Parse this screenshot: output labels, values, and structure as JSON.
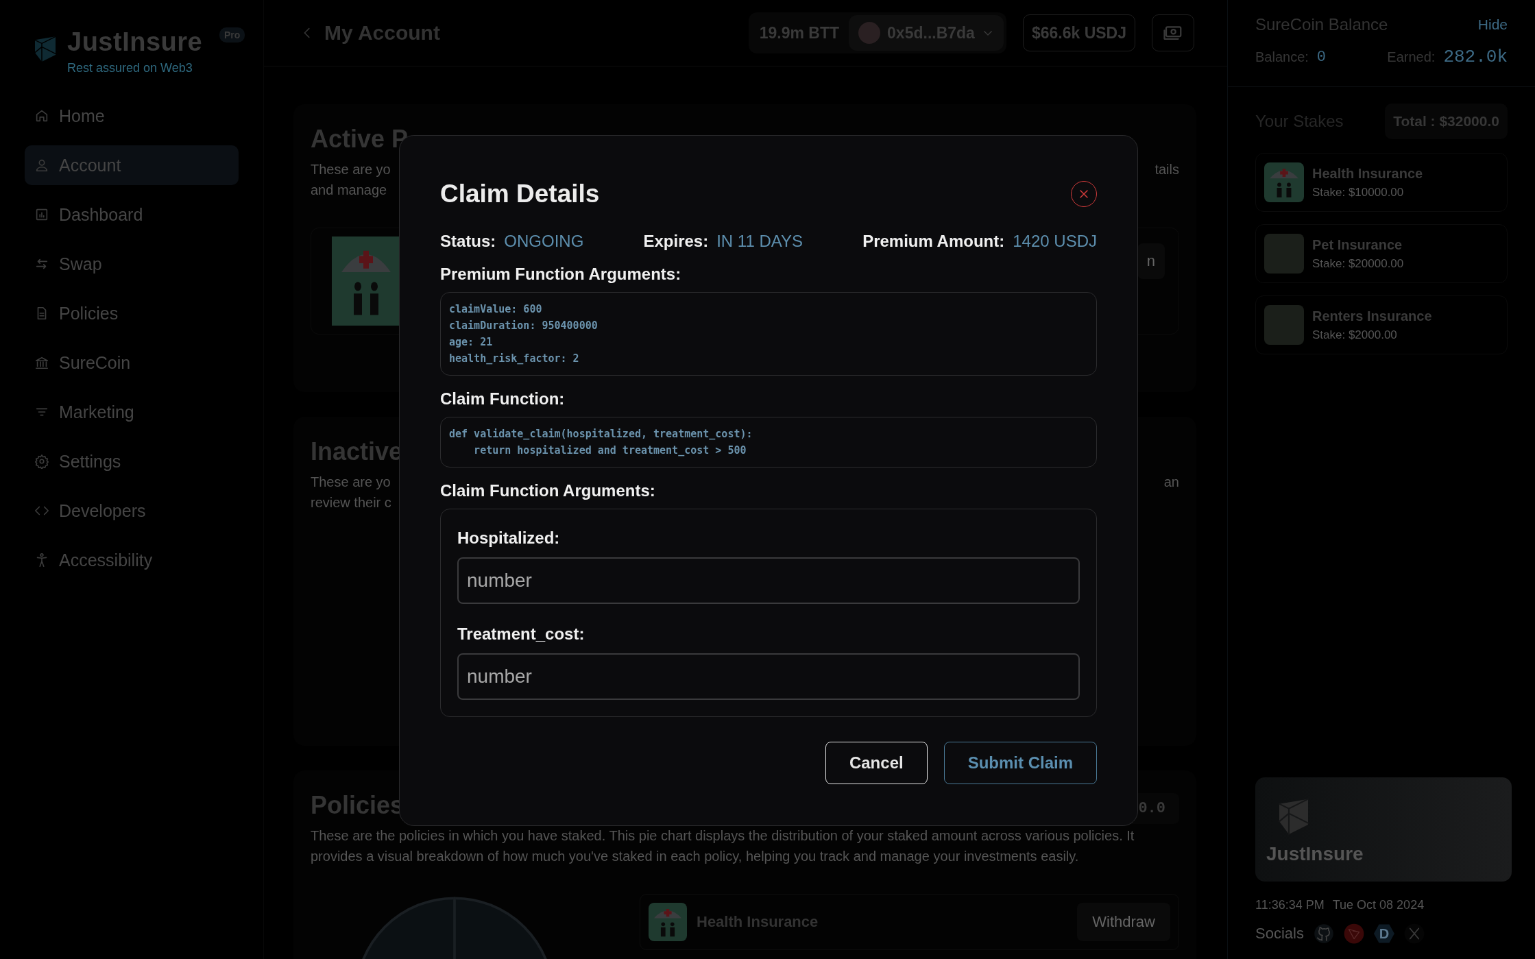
{
  "sidebar": {
    "logo": {
      "name": "JustInsure",
      "badge": "Pro",
      "tagline": "Rest assured on Web3"
    },
    "items": [
      {
        "label": "Home",
        "kind": "home",
        "selected": false
      },
      {
        "label": "Account",
        "kind": "user",
        "selected": true
      },
      {
        "label": "Dashboard",
        "kind": "chart",
        "selected": false
      },
      {
        "label": "Swap",
        "kind": "swap",
        "selected": false
      },
      {
        "label": "Policies",
        "kind": "doc",
        "selected": false
      },
      {
        "label": "SureCoin",
        "kind": "bank",
        "selected": false
      },
      {
        "label": "Marketing",
        "kind": "filter",
        "selected": false
      },
      {
        "label": "Settings",
        "kind": "gear",
        "selected": false
      },
      {
        "label": "Developers",
        "kind": "code",
        "selected": false
      },
      {
        "label": "Accessibility",
        "kind": "person",
        "selected": false
      }
    ]
  },
  "header": {
    "title": "My Account",
    "btt": "19.9m BTT",
    "address": "0x5d...B7da",
    "usdj": "$66.6k USDJ"
  },
  "sections": [
    {
      "kind": "active",
      "title": "Active P",
      "desc_left": [
        "These are yo",
        "and manage"
      ],
      "desc_right": "tails",
      "button_fragment": "n"
    },
    {
      "kind": "inactive",
      "title": "Inactive",
      "desc_left": [
        "These are yo",
        "review their c"
      ],
      "desc_right": "an"
    },
    {
      "kind": "policies",
      "title": "Policies",
      "total_fragment": "0.0",
      "description": "These are the policies in which you have staked. This pie chart displays the distribution of your staked amount across various policies. It provides a visual breakdown of how much you've staked in each policy, helping you track and manage your investments easily.",
      "stake_name": "Health Insurance",
      "stake_button": "Withdraw"
    }
  ],
  "right_panel": {
    "balance": {
      "title": "SureCoin Balance",
      "hide": "Hide",
      "balance_label": "Balance:",
      "balance_value": "0",
      "earned_label": "Earned:",
      "earned_value": "282.0k"
    },
    "stakes": {
      "title": "Your Stakes",
      "total": "Total : $32000.0",
      "items": [
        {
          "name": "Health Insurance",
          "stake": "Stake: $10000.00",
          "kind": "health"
        },
        {
          "name": "Pet Insurance",
          "stake": "Stake: $20000.00",
          "kind": "photo"
        },
        {
          "name": "Renters Insurance",
          "stake": "Stake: $2000.00",
          "kind": "photo"
        }
      ]
    },
    "footer": {
      "brand": "JustInsure",
      "time": "11:36:34 PM",
      "date": "Tue Oct 08 2024",
      "socials_label": "Socials",
      "socials": [
        {
          "kind": "github"
        },
        {
          "kind": "tron"
        },
        {
          "kind": "letter",
          "text": "D"
        },
        {
          "kind": "x"
        }
      ]
    }
  },
  "modal": {
    "title": "Claim Details",
    "meta": [
      {
        "label": "Status:",
        "value": "ONGOING"
      },
      {
        "label": "Expires:",
        "value": "IN 11 DAYS"
      },
      {
        "label": "Premium Amount:",
        "value": "1420 USDJ"
      }
    ],
    "premium_args": {
      "heading": "Premium Function Arguments:",
      "lines": [
        "claimValue: 600",
        "claimDuration: 950400000",
        "age: 21",
        "health_risk_factor: 2"
      ]
    },
    "claim_function": {
      "heading": "Claim Function:",
      "lines": [
        "def validate_claim(hospitalized, treatment_cost):",
        "    return hospitalized and treatment_cost > 500"
      ]
    },
    "claim_args": {
      "heading": "Claim Function Arguments:",
      "fields": [
        {
          "label": "Hospitalized:",
          "placeholder": "number"
        },
        {
          "label": "Treatment_cost:",
          "placeholder": "number"
        }
      ]
    },
    "buttons": [
      {
        "label": "Cancel",
        "kind": "secondary"
      },
      {
        "label": "Submit Claim",
        "kind": "primary"
      }
    ]
  }
}
